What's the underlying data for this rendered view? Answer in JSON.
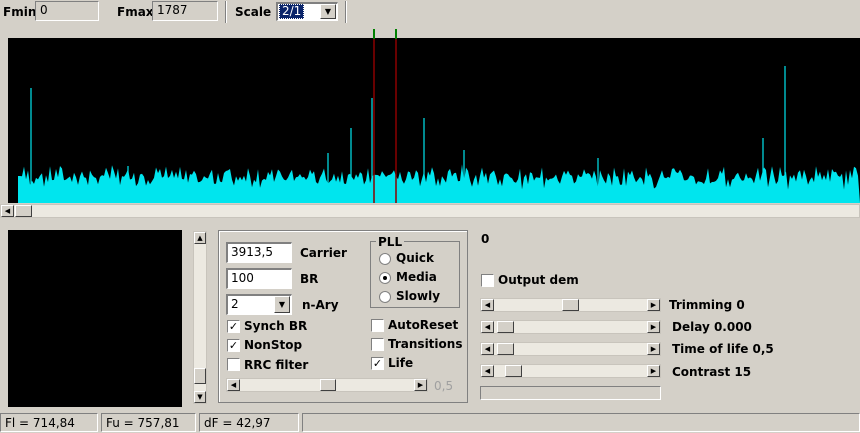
{
  "toolbar": {
    "fmin_label": "Fmin",
    "fmin_value": "0",
    "fmax_label": "Fmax",
    "fmax_value": "1787",
    "scale_label": "Scale",
    "scale_value": "2/1"
  },
  "spectrum": {
    "background": "#000000",
    "trace_color": "#00e5ee",
    "marker_color": "#8b0000",
    "marker_tick_color": "#00aa00"
  },
  "controls": {
    "carrier_value": "3913,5",
    "carrier_label": "Carrier",
    "br_value": "100",
    "br_label": "BR",
    "nary_value": "2",
    "nary_label": "n-Ary",
    "synch_br_label": "Synch BR",
    "synch_br_checked": true,
    "nonstop_label": "NonStop",
    "nonstop_checked": true,
    "rrc_filter_label": "RRC filter",
    "rrc_filter_checked": false,
    "slider_value_label": "0,5",
    "pll": {
      "title": "PLL",
      "options": [
        "Quick",
        "Media",
        "Slowly"
      ],
      "selected": "Media"
    },
    "autoreset_label": "AutoReset",
    "autoreset_checked": false,
    "transitions_label": "Transitions",
    "transitions_checked": false,
    "life_label": "Life",
    "life_checked": true
  },
  "right_panel": {
    "value_display": "0",
    "output_dem_label": "Output dem",
    "output_dem_checked": false,
    "trimming_label": "Trimming 0",
    "delay_label": "Delay  0.000",
    "time_of_life_label": "Time of life 0,5",
    "contrast_label": "Contrast 15"
  },
  "status": {
    "fl": "Fl = 714,84",
    "fu": "Fu = 757,81",
    "df": "dF = 42,97"
  }
}
